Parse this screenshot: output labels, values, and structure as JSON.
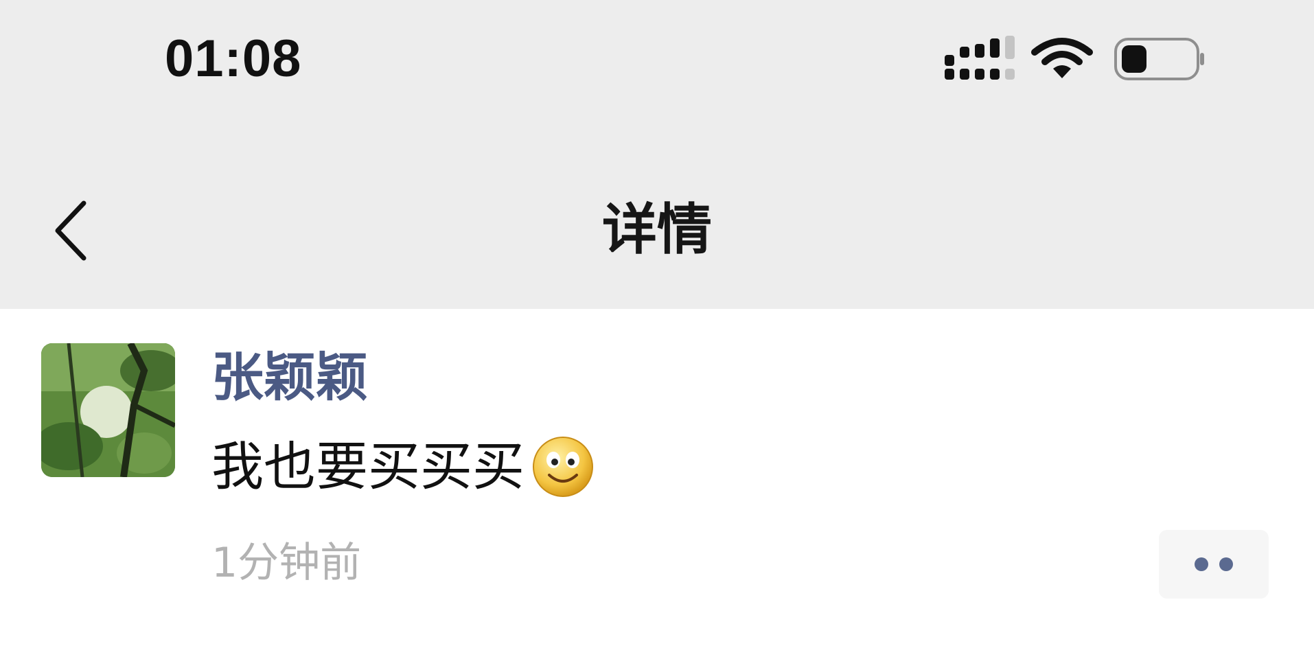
{
  "status_bar": {
    "time": "01:08",
    "signal_icon": "cellular-signal-icon",
    "wifi_icon": "wifi-icon",
    "battery_icon": "battery-icon",
    "battery_level": 0.35
  },
  "nav": {
    "back_icon": "chevron-left-icon",
    "title": "详情"
  },
  "comment": {
    "avatar_icon": "avatar-photo",
    "author": "张颖颖",
    "text": "我也要买买买",
    "emoji": "smile-emoji-icon",
    "time_ago": "1分钟前",
    "more_icon": "more-dots-icon"
  },
  "colors": {
    "header_bg": "#ededed",
    "author_name": "#4b5a84",
    "timestamp": "#b2b2b2",
    "more_dots": "#5b6a90"
  }
}
